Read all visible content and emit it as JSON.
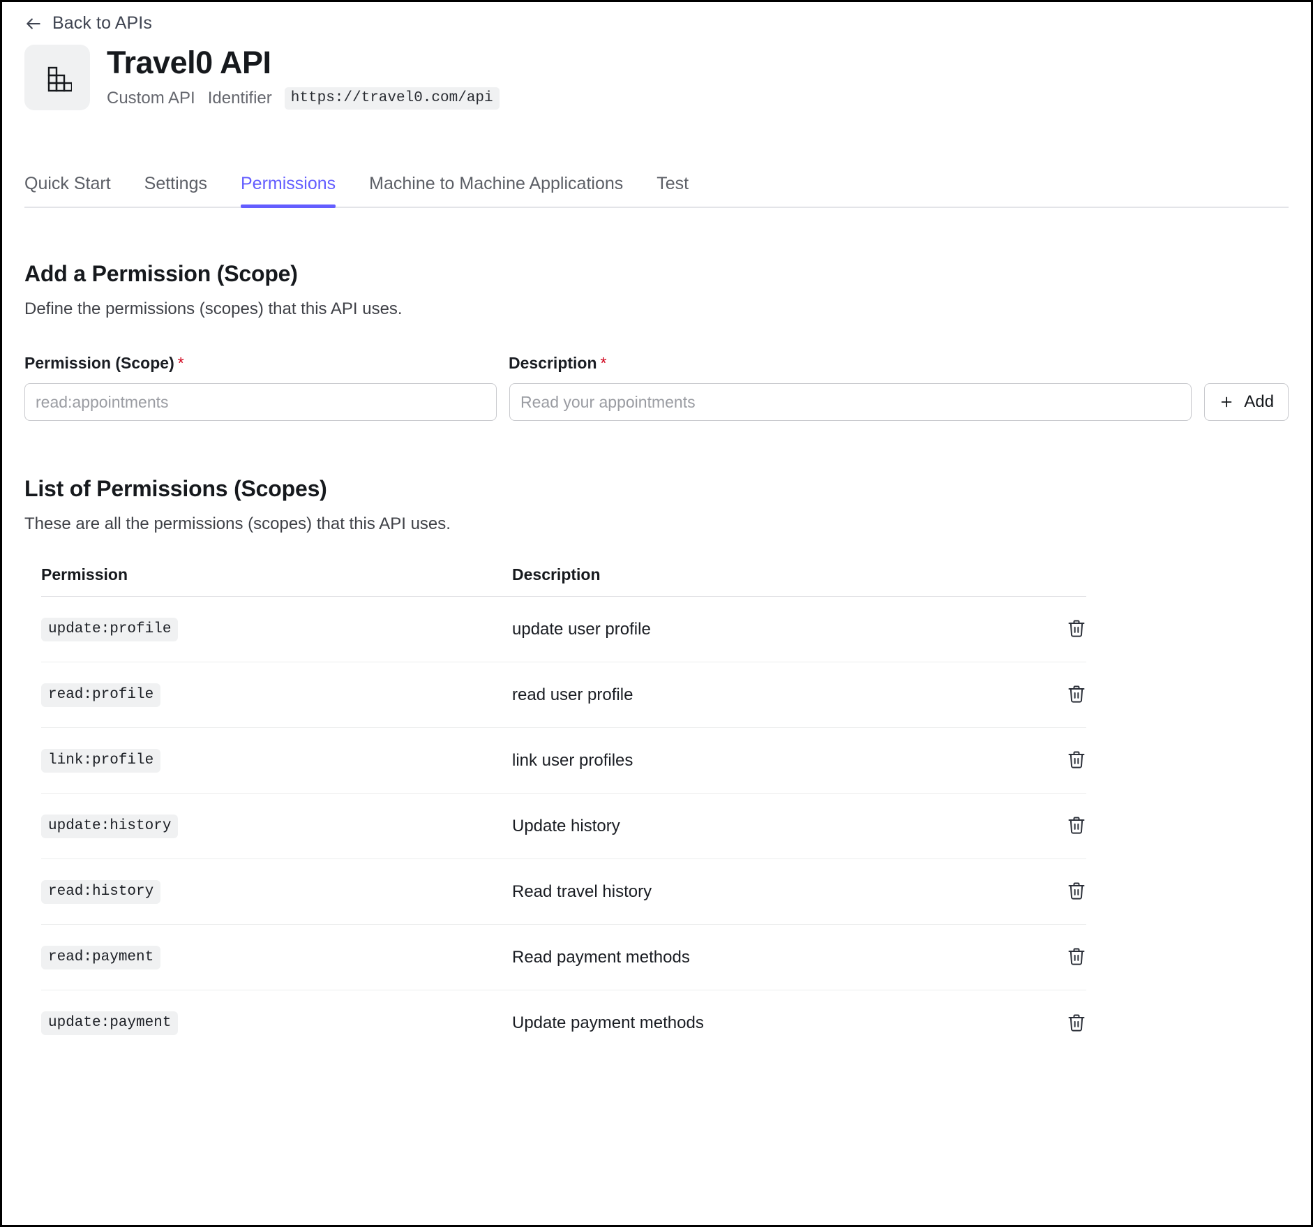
{
  "nav": {
    "back_label": "Back to APIs",
    "back_icon": "arrow-left-icon"
  },
  "header": {
    "logo_icon": "api-blocks-icon",
    "title": "Travel0 API",
    "api_type": "Custom API",
    "identifier_label": "Identifier",
    "identifier_value": "https://travel0.com/api"
  },
  "tabs": {
    "items": [
      {
        "label": "Quick Start",
        "active": false
      },
      {
        "label": "Settings",
        "active": false
      },
      {
        "label": "Permissions",
        "active": true
      },
      {
        "label": "Machine to Machine Applications",
        "active": false
      },
      {
        "label": "Test",
        "active": false
      }
    ],
    "active_color": "#635dff"
  },
  "add_permission": {
    "title": "Add a Permission (Scope)",
    "subtitle": "Define the permissions (scopes) that this API uses.",
    "scope_label": "Permission (Scope)",
    "scope_required_mark": "*",
    "scope_value": "",
    "scope_placeholder": "read:appointments",
    "description_label": "Description",
    "description_required_mark": "*",
    "description_value": "",
    "description_placeholder": "Read your appointments",
    "add_button_label": "Add",
    "add_button_icon": "plus-icon",
    "required_color": "#d0021b"
  },
  "permission_list": {
    "title": "List of Permissions (Scopes)",
    "subtitle": "These are all the permissions (scopes) that this API uses.",
    "columns": [
      "Permission",
      "Description"
    ],
    "delete_icon": "trash-icon",
    "rows": [
      {
        "permission": "update:profile",
        "description": "update user profile"
      },
      {
        "permission": "read:profile",
        "description": "read user profile"
      },
      {
        "permission": "link:profile",
        "description": "link user profiles"
      },
      {
        "permission": "update:history",
        "description": "Update history"
      },
      {
        "permission": "read:history",
        "description": "Read travel history"
      },
      {
        "permission": "read:payment",
        "description": "Read payment methods"
      },
      {
        "permission": "update:payment",
        "description": "Update payment methods"
      }
    ]
  }
}
